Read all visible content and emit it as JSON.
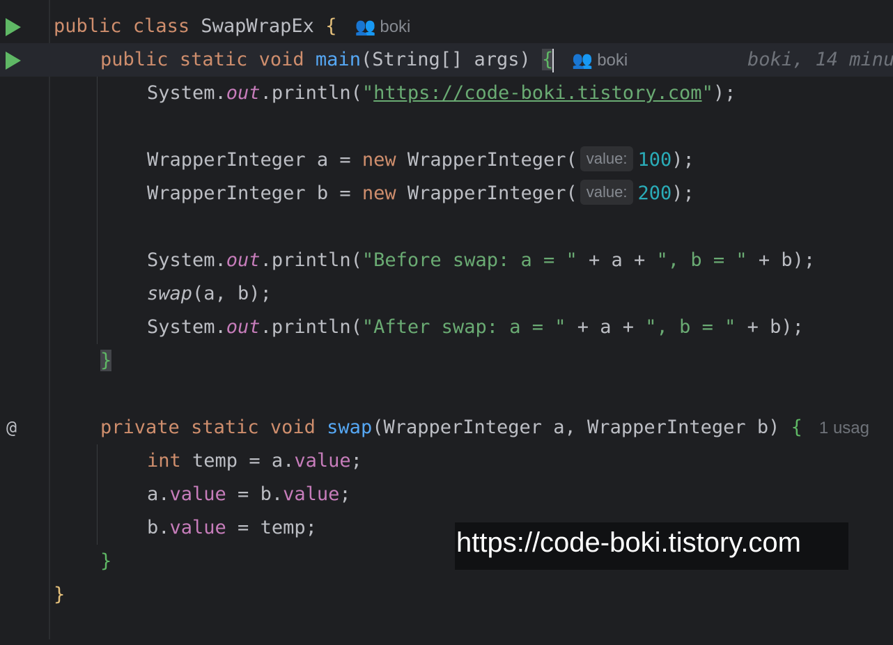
{
  "editor": {
    "line1": {
      "kw1": "public",
      "kw2": "class",
      "name": "SwapWrapEx",
      "brace": "{",
      "author": "boki"
    },
    "line2": {
      "kw1": "public",
      "kw2": "static",
      "kw3": "void",
      "fn": "main",
      "params": "(String[] args) ",
      "brace": "{",
      "author": "boki",
      "blame": "boki, 14 minu"
    },
    "line3": {
      "sys": "System.",
      "out": "out",
      "print": ".println(",
      "q1": "\"",
      "url": "https://code-boki.tistory.com",
      "q2": "\"",
      "end": ");"
    },
    "line5": {
      "type": "WrapperInteger a = ",
      "kw": "new",
      "ctor": " WrapperInteger(",
      "hint": "value:",
      "num": "100",
      "end": ");"
    },
    "line6": {
      "type": "WrapperInteger b = ",
      "kw": "new",
      "ctor": " WrapperInteger(",
      "hint": "value:",
      "num": "200",
      "end": ");"
    },
    "line8": {
      "sys": "System.",
      "out": "out",
      "print": ".println(",
      "s1": "\"Before swap: a = \"",
      "p1": " + a + ",
      "s2": "\", b = \"",
      "p2": " + b",
      "end": ");"
    },
    "line9": {
      "fn": "swap",
      "args": "(a, b);"
    },
    "line10": {
      "sys": "System.",
      "out": "out",
      "print": ".println(",
      "s1": "\"After swap: a = \"",
      "p1": " + a + ",
      "s2": "\", b = \"",
      "p2": " + b",
      "end": ");"
    },
    "line11": {
      "brace": "}"
    },
    "line13": {
      "kw1": "private",
      "kw2": "static",
      "kw3": "void",
      "fn": "swap",
      "params": "(WrapperInteger a, WrapperInteger b) ",
      "brace": "{",
      "usage": "1 usag"
    },
    "line14": {
      "kw": "int",
      "rest": " temp = a.",
      "fld": "value",
      "end": ";"
    },
    "line15": {
      "a": "a.",
      "fld1": "value",
      "mid": " = b.",
      "fld2": "value",
      "end": ";"
    },
    "line16": {
      "a": "b.",
      "fld": "value",
      "end": " = temp;"
    },
    "line17": {
      "brace": "}"
    },
    "line18": {
      "brace": "}"
    }
  },
  "gutter": {
    "at_symbol": "@",
    "run_icon": "run-triangle-icon"
  },
  "watermark": "https://code-boki.tistory.com",
  "colors": {
    "background": "#1e1f22",
    "keyword": "#cf8e6d",
    "function": "#56a8f5",
    "string": "#6aab73",
    "number": "#2aacb8",
    "field": "#c77dbb"
  }
}
